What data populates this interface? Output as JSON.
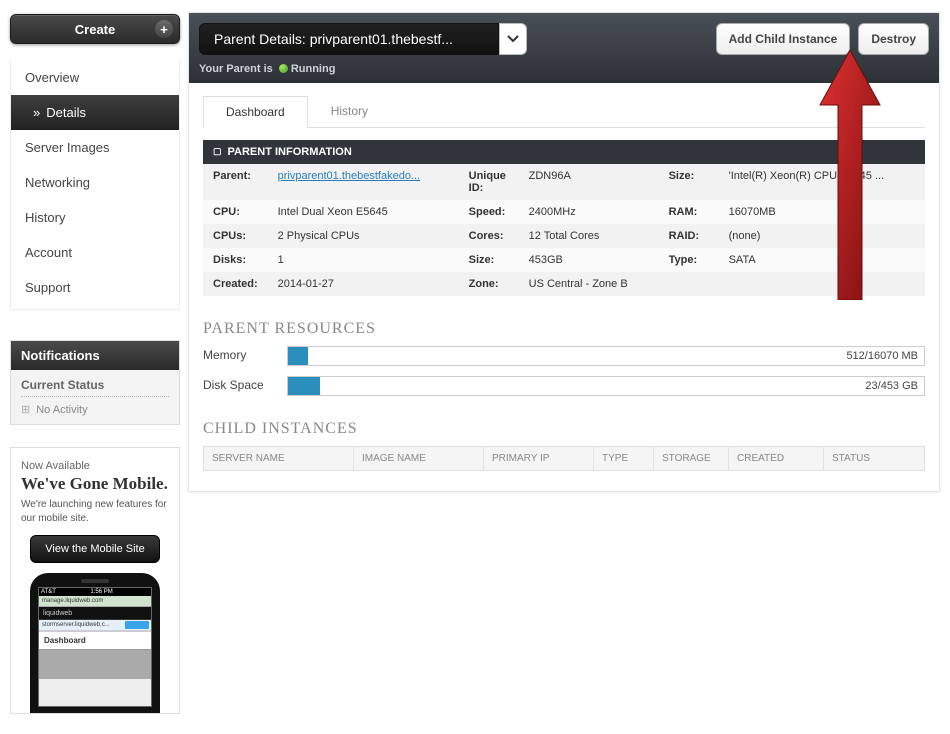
{
  "sidebar": {
    "create": {
      "label": "Create",
      "plus": "+"
    },
    "nav": [
      {
        "label": "Overview",
        "name": "nav-overview"
      },
      {
        "label": "Details",
        "name": "nav-details"
      },
      {
        "label": "Server Images",
        "name": "nav-server-images"
      },
      {
        "label": "Networking",
        "name": "nav-networking"
      },
      {
        "label": "History",
        "name": "nav-history"
      },
      {
        "label": "Account",
        "name": "nav-account"
      },
      {
        "label": "Support",
        "name": "nav-support"
      }
    ],
    "active_index": 1,
    "notifications": {
      "title": "Notifications",
      "status_label": "Current Status",
      "no_activity": "No Activity"
    },
    "mobile": {
      "now": "Now Available",
      "headline": "We've Gone Mobile.",
      "sub": "We're launching new features for our mobile site.",
      "button": "View the Mobile Site",
      "screen_brand": "liquidweb",
      "screen_url1": "manage.liquidweb.com",
      "screen_url2": "stormserver.liquidweb.c...",
      "phone_status_left": "AT&T",
      "phone_status_mid": "1:56 PM",
      "screen_tab": "Dashboard"
    }
  },
  "header": {
    "title": "Parent Details: privparent01.thebestf...",
    "add_child": "Add Child Instance",
    "destroy": "Destroy",
    "status_prefix": "Your Parent is ",
    "status_word": "Running"
  },
  "tabs": {
    "list": [
      "Dashboard",
      "History"
    ],
    "active_index": 0
  },
  "parent_info": {
    "title": "PARENT INFORMATION",
    "rows": [
      {
        "k1": "Parent:",
        "v1": "privparent01.thebestfakedo...",
        "k2": "Unique ID:",
        "v2": "ZDN96A",
        "k3": "Size:",
        "v3": "'Intel(R) Xeon(R) CPU E5645 ..."
      },
      {
        "k1": "CPU:",
        "v1": "Intel Dual Xeon E5645",
        "k2": "Speed:",
        "v2": "2400MHz",
        "k3": "RAM:",
        "v3": "16070MB"
      },
      {
        "k1": "CPUs:",
        "v1": "2 Physical CPUs",
        "k2": "Cores:",
        "v2": "12 Total Cores",
        "k3": "RAID:",
        "v3": "(none)"
      },
      {
        "k1": "Disks:",
        "v1": "1",
        "k2": "Size:",
        "v2": "453GB",
        "k3": "Type:",
        "v3": "SATA"
      },
      {
        "k1": "Created:",
        "v1": "2014-01-27",
        "k2": "Zone:",
        "v2": "US Central - Zone B",
        "k3": "",
        "v3": ""
      }
    ]
  },
  "resources": {
    "title": "PARENT RESOURCES",
    "items": [
      {
        "label": "Memory",
        "text": "512/16070 MB",
        "pct": 3.2
      },
      {
        "label": "Disk Space",
        "text": "23/453 GB",
        "pct": 5.1
      }
    ]
  },
  "children": {
    "title": "CHILD INSTANCES",
    "headers": [
      "SERVER NAME",
      "IMAGE NAME",
      "PRIMARY IP",
      "TYPE",
      "STORAGE",
      "CREATED",
      "STATUS"
    ]
  }
}
